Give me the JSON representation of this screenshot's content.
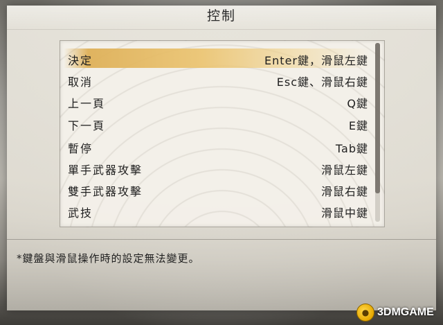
{
  "dialog": {
    "title": "控制",
    "bindings": [
      {
        "action": "決定",
        "key": "Enter鍵，滑鼠左鍵",
        "selected": true
      },
      {
        "action": "取消",
        "key": "Esc鍵、滑鼠右鍵",
        "selected": false
      },
      {
        "action": "上一頁",
        "key": "Q鍵",
        "selected": false
      },
      {
        "action": "下一頁",
        "key": "E鍵",
        "selected": false
      },
      {
        "action": "暫停",
        "key": "Tab鍵",
        "selected": false
      },
      {
        "action": "單手武器攻擊",
        "key": "滑鼠左鍵",
        "selected": false
      },
      {
        "action": "雙手武器攻擊",
        "key": "滑鼠右鍵",
        "selected": false
      },
      {
        "action": "武技",
        "key": "滑鼠中鍵",
        "selected": false
      }
    ],
    "scroll": {
      "visible_fraction": 0.84,
      "position_fraction": 0.0
    },
    "note": "*鍵盤與滑鼠操作時的設定無法變更。"
  },
  "watermark": {
    "logo_text": "3DMGAME",
    "icon": "3dm-logo-icon"
  },
  "colors": {
    "selection": "#deb058",
    "text": "#1f1f1f",
    "panel": "#f4f1ea"
  }
}
